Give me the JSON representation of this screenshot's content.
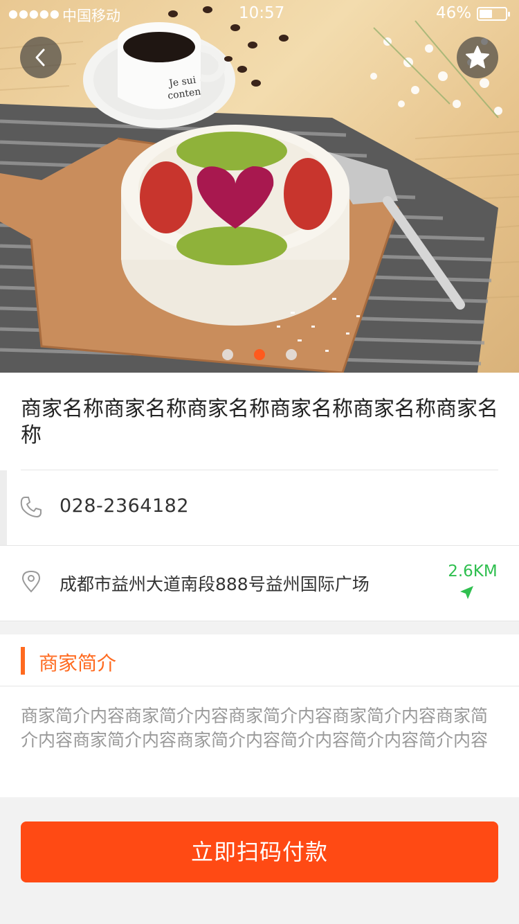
{
  "status_bar": {
    "signal": "●●●●●",
    "carrier": "中国移动",
    "time": "10:57",
    "battery": "46%"
  },
  "hero": {
    "back_icon": "chevron-left-icon",
    "favorite_icon": "star-icon",
    "carousel_total": 3,
    "carousel_active": 2,
    "cup_text_line1": "Je sui",
    "cup_text_line2": "conten"
  },
  "shop": {
    "name": "商家名称商家名称商家名称商家名称商家名称商家名称",
    "phone": "028-2364182",
    "address": "成都市益州大道南段888号益州国际广场",
    "distance": "2.6KM"
  },
  "intro": {
    "title": "商家简介",
    "content": "商家简介内容商家简介内容商家简介内容商家简介内容商家简介内容商家简介内容商家简介内容简介内容简介内容简介内容"
  },
  "actions": {
    "pay_label": "立即扫码付款"
  },
  "colors": {
    "accent": "#ff4a14",
    "intro_accent": "#ff6a1f",
    "distance": "#2fbf4f",
    "carousel_active": "#ff5a1d"
  }
}
